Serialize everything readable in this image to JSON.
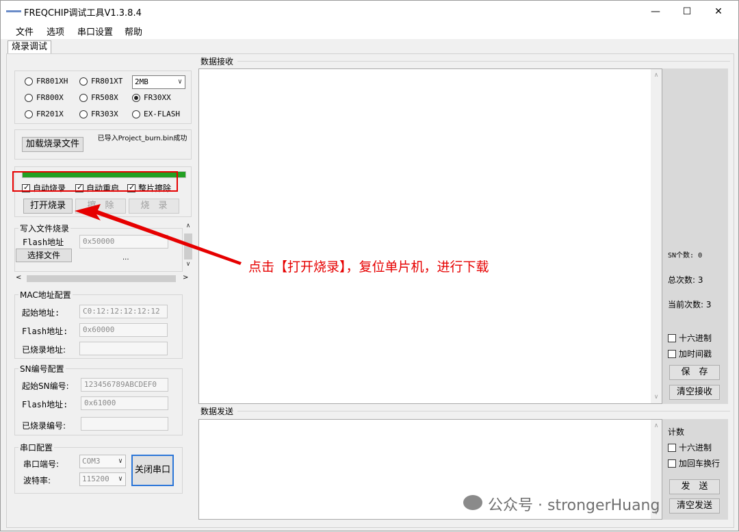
{
  "window": {
    "title": "FREQCHIP调试工具V1.3.8.4",
    "minimize": "—",
    "maximize": "☐",
    "close": "✕"
  },
  "menu": [
    "文件",
    "选项",
    "串口设置",
    "帮助"
  ],
  "tab": "烧录调试",
  "chip": {
    "options": [
      "FR801XH",
      "FR801XT",
      "FR800X",
      "FR508X",
      "FR30XX",
      "FR201X",
      "FR303X",
      "EX-FLASH"
    ],
    "selected": "FR30XX",
    "flash_size": "2MB"
  },
  "load": {
    "button": "加载烧录文件",
    "status": "已导入Project_burn.bin成功"
  },
  "progress": {
    "fraction": 1.0,
    "color": "#22a022"
  },
  "options": {
    "auto_burn": "自动烧录",
    "auto_reset": "自动重启",
    "chip_erase": "整片擦除"
  },
  "actions": {
    "open_burn": "打开烧录",
    "erase": "擦　除",
    "burn": "烧　录"
  },
  "write_file": {
    "title": "写入文件烧录",
    "flash_label": "Flash地址",
    "flash_value": "0x50000",
    "select_button": "选择文件",
    "ellipsis": "..."
  },
  "mac": {
    "title": "MAC地址配置",
    "start_label": "起始地址:",
    "start_value": "C0:12:12:12:12:12",
    "flash_label": "Flash地址:",
    "flash_value": "0x60000",
    "burned_label": "已烧录地址:",
    "burned_value": ""
  },
  "sn": {
    "title": "SN编号配置",
    "start_label": "起始SN编号:",
    "start_value": "123456789ABCDEF0",
    "flash_label": "Flash地址:",
    "flash_value": "0x61000",
    "burned_label": "已烧录编号:",
    "burned_value": ""
  },
  "serial": {
    "title": "串口配置",
    "port_label": "串口端号:",
    "port_value": "COM3",
    "baud_label": "波特率:",
    "baud_value": "115200",
    "close_button": "关闭串口"
  },
  "receive": {
    "title": "数据接收",
    "sn_count": "SN个数: 0",
    "total": "总次数: 3",
    "current": "当前次数: 3",
    "hex": "十六进制",
    "timestamp": "加时间戳",
    "save": "保　存",
    "clear": "清空接收"
  },
  "send": {
    "title": "数据发送",
    "count": "计数",
    "hex": "十六进制",
    "crlf": "加回车换行",
    "send": "发　送",
    "clear": "清空发送"
  },
  "annotation": "点击【打开烧录】，复位单片机，进行下载",
  "watermark": "公众号 · strongerHuang"
}
